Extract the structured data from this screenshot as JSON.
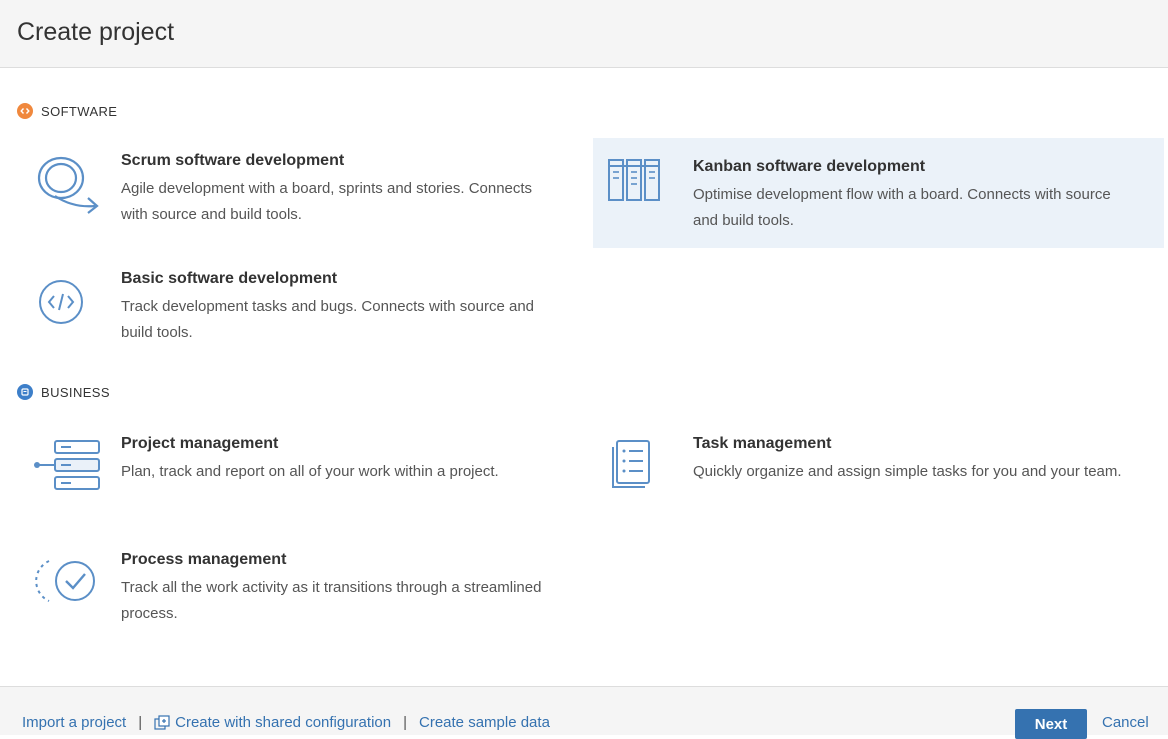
{
  "dialog": {
    "title": "Create project"
  },
  "colors": {
    "software": "#f0883d",
    "business": "#3d7fc9",
    "link": "#3572b0",
    "selected_bg": "#ebf2f9",
    "icon": "#5b8fc7"
  },
  "sections": {
    "software": {
      "label": "SOFTWARE",
      "badge_icon": "code-icon",
      "templates": [
        {
          "title": "Scrum software development",
          "description": "Agile development with a board, sprints and stories. Connects with source and build tools.",
          "icon": "scrum-cycle-icon"
        },
        {
          "title": "Kanban software development",
          "description": "Optimise development flow with a board. Connects with source and build tools.",
          "icon": "kanban-board-icon",
          "selected": true
        },
        {
          "title": "Basic software development",
          "description": "Track development tasks and bugs. Connects with source and build tools.",
          "icon": "code-brackets-icon"
        }
      ]
    },
    "business": {
      "label": "BUSINESS",
      "badge_icon": "document-icon",
      "templates": [
        {
          "title": "Project management",
          "description": "Plan, track and report on all of your work within a project.",
          "icon": "project-stack-icon"
        },
        {
          "title": "Task management",
          "description": "Quickly organize and assign simple tasks for you and your team.",
          "icon": "task-list-icon"
        },
        {
          "title": "Process management",
          "description": "Track all the work activity as it transitions through a streamlined process.",
          "icon": "process-check-icon"
        }
      ]
    }
  },
  "footer": {
    "import_label": "Import a project",
    "shared_config_label": "Create with shared configuration",
    "sample_data_label": "Create sample data",
    "separator": "|",
    "next_label": "Next",
    "cancel_label": "Cancel"
  }
}
